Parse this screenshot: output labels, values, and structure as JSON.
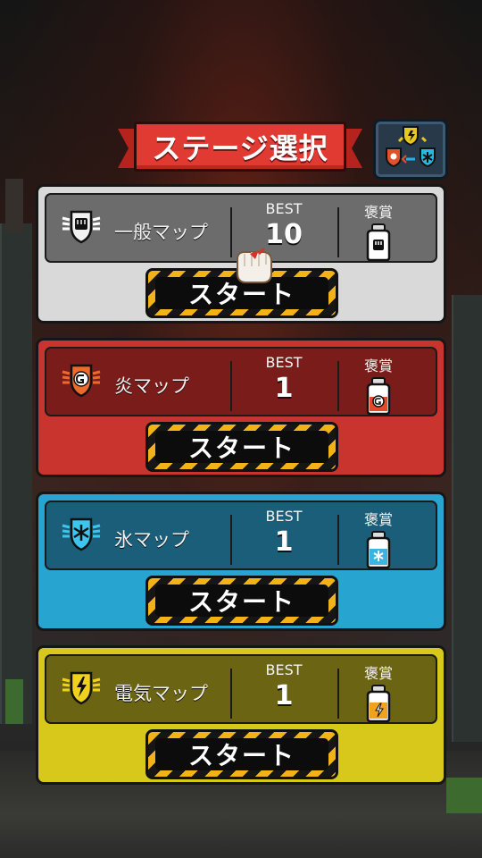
{
  "title": "ステージ選択",
  "switch_button": {
    "icon": "element-cycle-icon"
  },
  "stages": [
    {
      "key": "normal",
      "name": "一般マップ",
      "best_label": "BEST",
      "best": "10",
      "reward_label": "褒賞",
      "start_label": "スタート",
      "accent": "#d9d9d9",
      "emblem": "fist-emblem-icon",
      "reward_icon": "fist-bottle-icon"
    },
    {
      "key": "fire",
      "name": "炎マップ",
      "best_label": "BEST",
      "best": "1",
      "reward_label": "褒賞",
      "start_label": "スタート",
      "accent": "#c9342e",
      "emblem": "fire-emblem-icon",
      "reward_icon": "fire-bottle-icon"
    },
    {
      "key": "ice",
      "name": "氷マップ",
      "best_label": "BEST",
      "best": "1",
      "reward_label": "褒賞",
      "start_label": "スタート",
      "accent": "#27a4cf",
      "emblem": "ice-emblem-icon",
      "reward_icon": "ice-bottle-icon"
    },
    {
      "key": "electric",
      "name": "電気マップ",
      "best_label": "BEST",
      "best": "1",
      "reward_label": "褒賞",
      "start_label": "スタート",
      "accent": "#d8c81b",
      "emblem": "lightning-emblem-icon",
      "reward_icon": "lightning-bottle-icon"
    }
  ],
  "colors": {
    "banner": "#e13a33",
    "hazard_yellow": "#f3b318",
    "hazard_black": "#161616"
  }
}
